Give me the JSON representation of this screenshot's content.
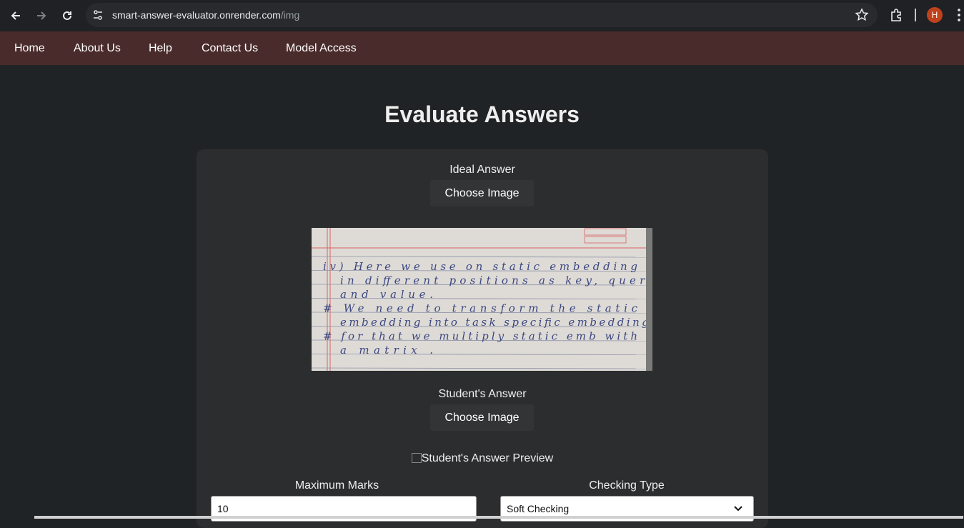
{
  "browser": {
    "url_host": "smart-answer-evaluator.onrender.com",
    "url_path": "/img",
    "profile_initial": "H"
  },
  "nav": {
    "items": [
      "Home",
      "About Us",
      "Help",
      "Contact Us",
      "Model Access"
    ]
  },
  "page": {
    "title": "Evaluate Answers"
  },
  "ideal": {
    "label": "Ideal Answer",
    "button": "Choose Image",
    "image_lines": [
      "iv) Here we use on static embedding",
      "in different positions as key, query",
      "and value.",
      "# We need to transform the static",
      "embedding into task specific embedding.",
      "# for that we multiply static emb with",
      "a matrix ."
    ]
  },
  "student": {
    "label": "Student's Answer",
    "button": "Choose Image",
    "preview_alt": "Student's Answer Preview"
  },
  "form": {
    "max_marks_label": "Maximum Marks",
    "max_marks_value": "10",
    "checking_type_label": "Checking Type",
    "checking_type_value": "Soft Checking"
  }
}
